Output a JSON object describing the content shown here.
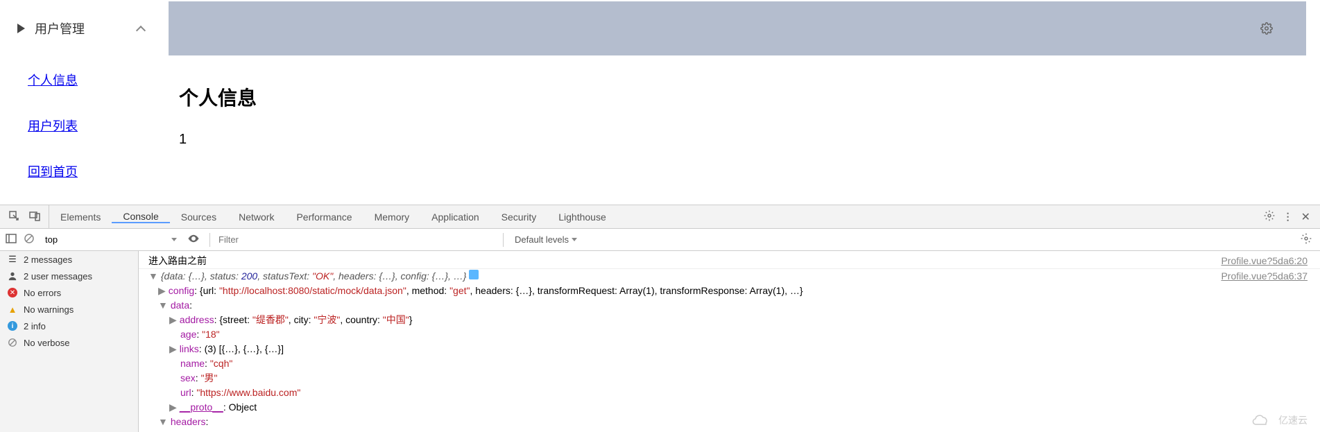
{
  "sidebar": {
    "header": "用户管理",
    "items": [
      "个人信息",
      "用户列表",
      "回到首页"
    ]
  },
  "main": {
    "title": "个人信息",
    "content": "1"
  },
  "devtools": {
    "tabs": [
      "Elements",
      "Console",
      "Sources",
      "Network",
      "Performance",
      "Memory",
      "Application",
      "Security",
      "Lighthouse"
    ],
    "active_tab": "Console",
    "toolbar": {
      "context": "top",
      "filter_placeholder": "Filter",
      "levels": "Default levels"
    },
    "sidebar_items": [
      {
        "icon": "messages",
        "label": "2 messages"
      },
      {
        "icon": "user",
        "label": "2 user messages"
      },
      {
        "icon": "error",
        "label": "No errors"
      },
      {
        "icon": "warning",
        "label": "No warnings"
      },
      {
        "icon": "info",
        "label": "2 info"
      },
      {
        "icon": "verbose",
        "label": "No verbose"
      }
    ],
    "console": {
      "line1": "进入路由之前",
      "src1": "Profile.vue?5da6:20",
      "src2": "Profile.vue?5da6:37",
      "obj_preview": {
        "prefix": "{data: {…}, status: ",
        "status": "200",
        "mid1": ", statusText: ",
        "statusText": "\"OK\"",
        "mid2": ", headers: {…}, config: {…}, …}"
      },
      "config_line": {
        "key": "config",
        "val": ": {url: ",
        "url": "\"http://localhost:8080/static/mock/data.json\"",
        "mid": ", method: ",
        "method": "\"get\"",
        "rest": ", headers: {…}, transformRequest: Array(1), transformResponse: Array(1), …}"
      },
      "data_key": "data",
      "address": {
        "key": "address",
        "prefix": ": {street: ",
        "street": "\"缇香郡\"",
        "mid1": ", city: ",
        "city": "\"宁波\"",
        "mid2": ", country: ",
        "country": "\"中国\"",
        "suffix": "}"
      },
      "age": {
        "key": "age",
        "sep": ": ",
        "val": "\"18\""
      },
      "links": {
        "key": "links",
        "val": ": (3) [{…}, {…}, {…}]"
      },
      "name": {
        "key": "name",
        "sep": ": ",
        "val": "\"cqh\""
      },
      "sex": {
        "key": "sex",
        "sep": ": ",
        "val": "\"男\""
      },
      "url": {
        "key": "url",
        "sep": ": ",
        "val": "\"https://www.baidu.com\""
      },
      "proto": {
        "key": "__proto__",
        "sep": ": ",
        "val": "Object"
      },
      "headers_key": "headers"
    }
  },
  "watermark": "亿速云"
}
